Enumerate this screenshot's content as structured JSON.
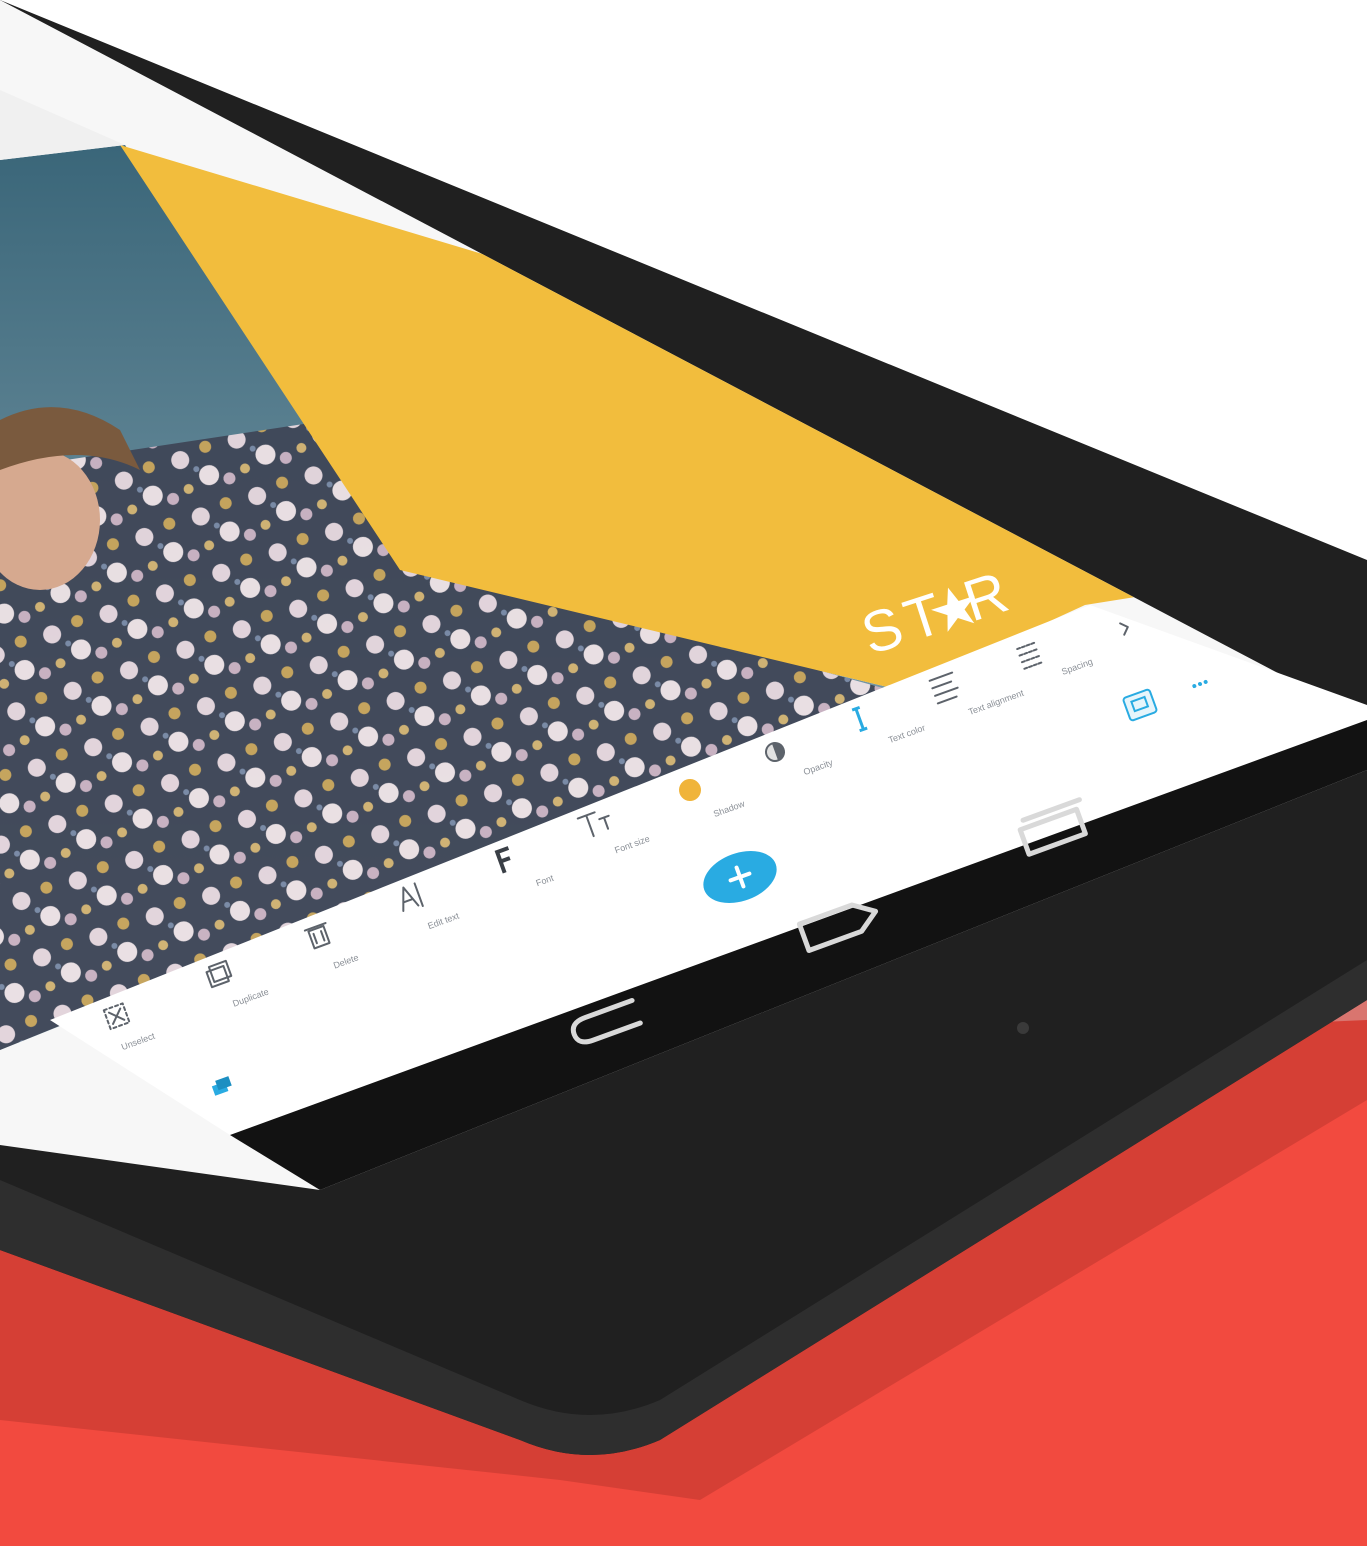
{
  "colors": {
    "background_surface": "#f24a3f",
    "device_body": "#202020",
    "poster_yellow": "#f2bd3d",
    "sky_blue": "#3d6b7d",
    "toolbar_bg": "#ffffff",
    "accent_blue": "#29abe2",
    "yellow_swatch": "#f0b43a"
  },
  "poster": {
    "brand_text": "ST R",
    "brand_star_icon": "star-icon"
  },
  "toolbar": {
    "items": [
      {
        "label": "Unselect",
        "icon": "unselect-icon"
      },
      {
        "label": "Duplicate",
        "icon": "duplicate-icon"
      },
      {
        "label": "Delete",
        "icon": "delete-icon"
      },
      {
        "label": "Edit text",
        "icon": "edit-text-icon"
      },
      {
        "label": "Font",
        "icon": "font-icon"
      },
      {
        "label": "Font size",
        "icon": "font-size-icon"
      },
      {
        "label": "Shadow",
        "icon": "shadow-swatch-icon"
      },
      {
        "label": "Opacity",
        "icon": "opacity-icon"
      },
      {
        "label": "Text color",
        "icon": "text-color-icon"
      },
      {
        "label": "Text alignment",
        "icon": "text-alignment-icon"
      },
      {
        "label": "Spacing",
        "icon": "spacing-icon"
      }
    ],
    "add_button_icon": "plus-icon",
    "layers_icon": "layers-icon",
    "save_icon": "save-icon",
    "more_icon": "more-icon",
    "scroll_right_icon": "chevron-right-icon"
  },
  "android_nav": {
    "back_icon": "back-icon",
    "home_icon": "home-icon",
    "recents_icon": "recents-icon"
  }
}
